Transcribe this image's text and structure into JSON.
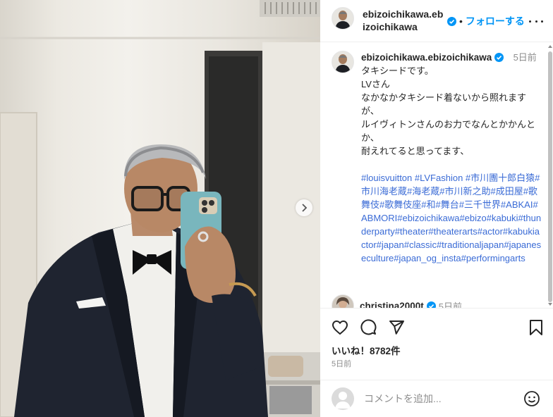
{
  "post": {
    "header": {
      "username": "ebizoichikawa.ebizoichikawa",
      "separator": "•",
      "follow_label": "フォローする",
      "verified_icon": "verified-badge-icon",
      "more_icon": "more-options-icon"
    },
    "caption": {
      "username": "ebizoichikawa.ebizoichikawa",
      "time": "5日前",
      "lines": [
        "タキシードです。",
        "LVさん",
        "なかなかタキシード着ないから照れますが、",
        "ルイヴィトンさんのお力でなんとかかんとか、",
        "耐えれてると思ってます、"
      ],
      "hashtags": "#louisvuitton #LVFashion #市川團十郎白猿#市川海老蔵#海老蔵#市川新之助#成田屋#歌舞伎#歌舞伎座#和#舞台#三千世界#ABKAI#ABMORI#ebizoichikawa#ebizo#kabuki#thunderparty#theater#theaterarts#actor#kabukiactor#japan#classic#traditionaljapan#japaneseculture#japan_og_insta#performingarts"
    },
    "comments": [
      {
        "username": "christina2000t",
        "time": "5日前"
      }
    ],
    "actions": {
      "like_icon": "heart-icon",
      "comment_icon": "comment-icon",
      "share_icon": "share-icon",
      "save_icon": "bookmark-icon"
    },
    "likes_text": "いいね！8782件",
    "posted": "5日前",
    "add_comment": {
      "placeholder": "コメントを追加...",
      "emoji_icon": "emoji-icon"
    },
    "carousel": {
      "next_icon": "chevron-right-icon"
    }
  },
  "colors": {
    "link": "#0095f6",
    "hashtag": "#3a6bd6",
    "verified": "#0095f6",
    "muted": "#8e8e8e",
    "text": "#262626"
  }
}
